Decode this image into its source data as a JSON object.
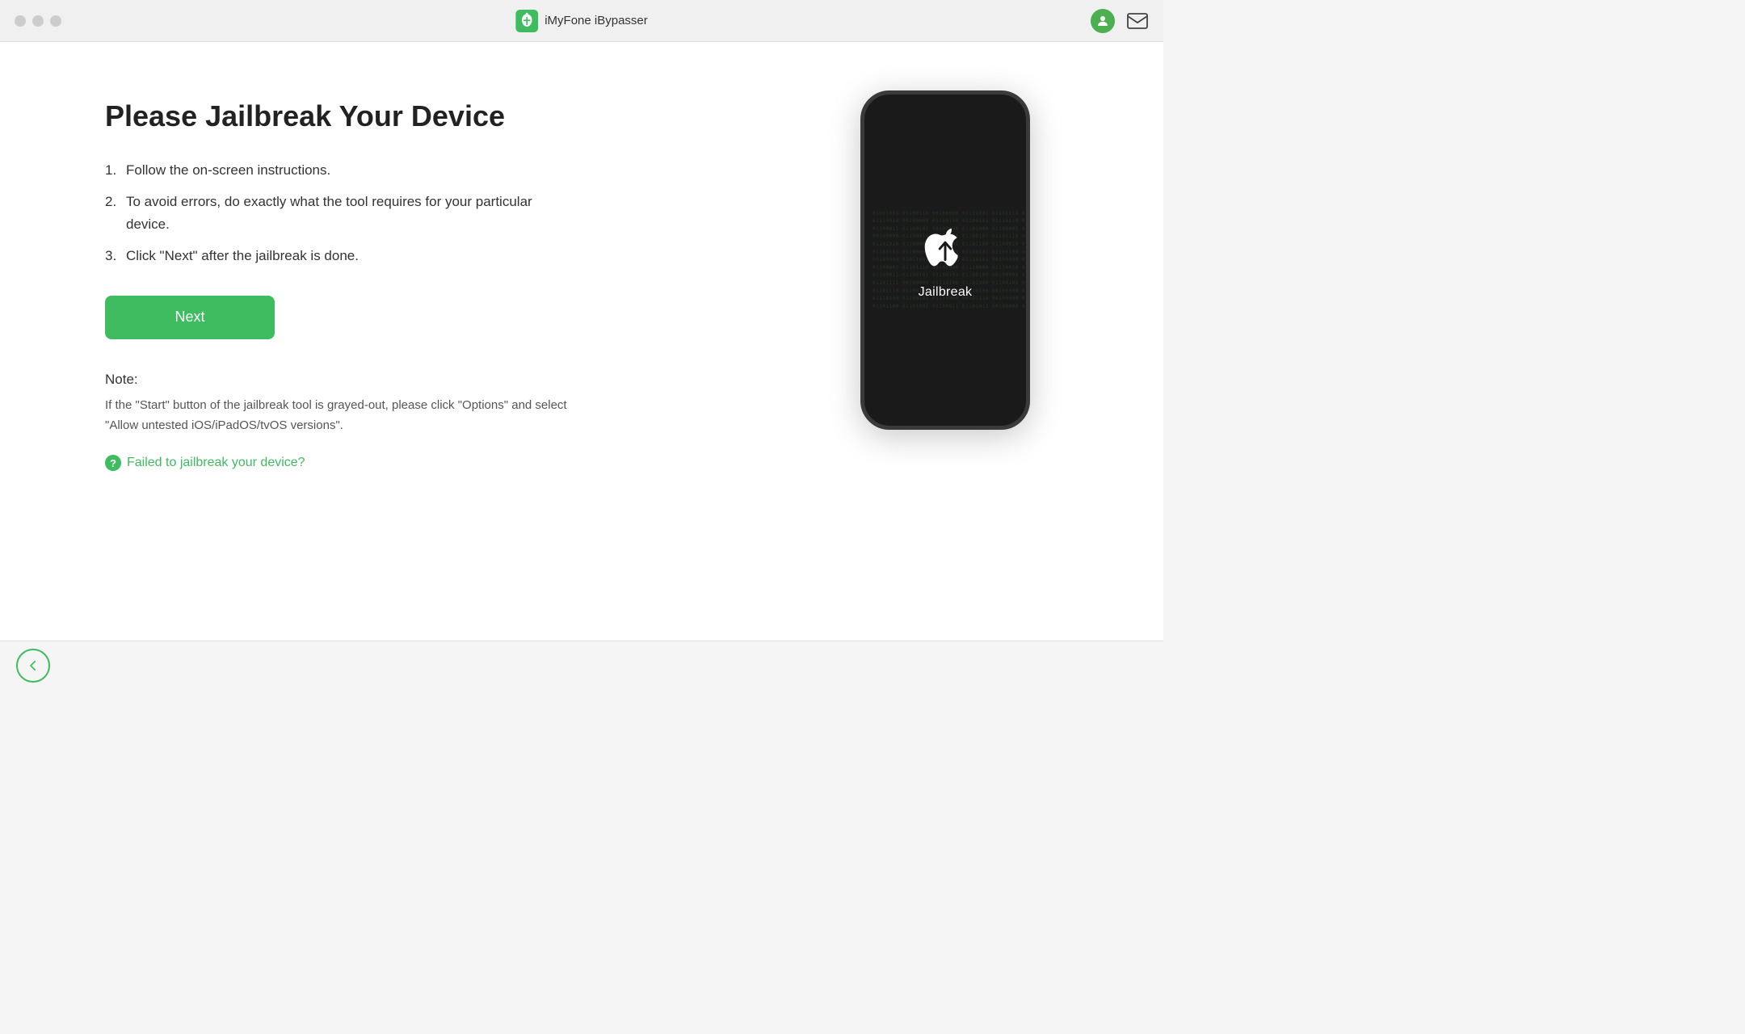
{
  "titlebar": {
    "title": "iMyFone iBypasser",
    "logo_alt": "iMyFone logo"
  },
  "main": {
    "page_title": "Please Jailbreak Your Device",
    "instructions": [
      {
        "num": "1.",
        "text": "Follow the on-screen instructions."
      },
      {
        "num": "2.",
        "text": "To avoid errors, do exactly what the tool requires for your particular device."
      },
      {
        "num": "3.",
        "text": "Click \"Next\" after the jailbreak is done."
      }
    ],
    "next_button_label": "Next",
    "note_label": "Note:",
    "note_text": "If the \"Start\" button of the jailbreak tool is grayed-out, please click \"Options\" and select \"Allow untested iOS/iPadOS/tvOS versions\".",
    "failed_link_text": "Failed to jailbreak your device?",
    "phone_jailbreak_label": "Jailbreak",
    "phone_bg_lines": [
      "01001001 01100110 00100000 01111001 01101111 01110101",
      "01110010 00100000 01100100 01100101 01110110 01101001",
      "01100011 01100101 00100000 01101000 01100001 01110011",
      "00100000 01100010 01100101 01100101 01101110 00100000",
      "01101010 01100001 01101001 01101100 01100010 01110010",
      "01100101 01100001 01101011 01100101 01100100 00101110",
      "00100000 01011001 01101111 01110101 00100000 01100011",
      "01100001 01101110 00100000 01110000 01110010 01101111",
      "01100011 01100101 01100101 01100100 00100000 01110100",
      "01101111 00100000 01110100 01101000 01100101 00100000",
      "01101110 01100101 01111000 01110100 00100000 01110011",
      "01110100 01100101 01110000 00101110 00100000 01000011",
      "01101100 01101001 01100011 01101011 00100000 01001110"
    ]
  },
  "bottom": {
    "back_icon": "←"
  },
  "colors": {
    "green": "#3ebc5f",
    "dark": "#1a1a1a",
    "text_dark": "#222",
    "text_mid": "#333",
    "text_light": "#555"
  }
}
